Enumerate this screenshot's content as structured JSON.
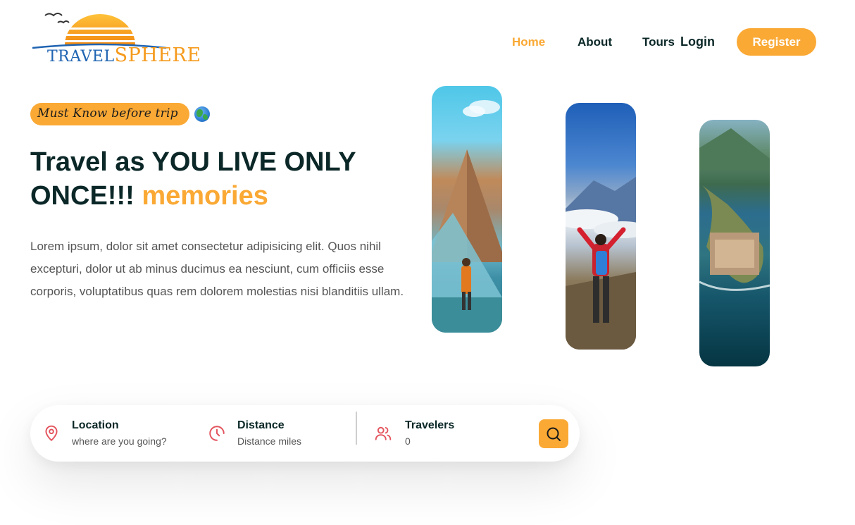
{
  "brand": {
    "logo_text_part1": "TRAVEL",
    "logo_text_part2": "SPHERE",
    "colors": {
      "accent": "#faa935",
      "heading": "#0b2727",
      "logo_blue": "#1f64b2",
      "icon_red": "#e4545e"
    }
  },
  "nav": {
    "links": [
      {
        "label": "Home",
        "active": true
      },
      {
        "label": "About",
        "active": false
      },
      {
        "label": "Tours",
        "active": false
      }
    ],
    "login_label": "Login",
    "register_label": "Register"
  },
  "hero": {
    "subtitle": "Must Know before trip",
    "subtitle_icon": "globe-icon",
    "headline_main": "Travel as YOU LIVE ONLY ONCE!!! ",
    "headline_highlight": "memories",
    "description": "Lorem ipsum, dolor sit amet consectetur adipisicing elit. Quos nihil excepturi, dolor ut ab minus ducimus ea nesciunt, cum officiis esse corporis, voluptatibus quas rem dolorem molestias nisi blanditiis ullam.",
    "images": [
      "louvre-pyramid-photo",
      "mountain-hiker-photo",
      "coastal-fort-aerial-photo"
    ]
  },
  "search": {
    "location": {
      "label": "Location",
      "placeholder": "where are you going?",
      "icon": "map-pin-icon"
    },
    "distance": {
      "label": "Distance",
      "placeholder": "Distance miles",
      "icon": "clock-icon"
    },
    "travelers": {
      "label": "Travelers",
      "placeholder": "0",
      "icon": "users-icon"
    },
    "button_icon": "search-icon"
  }
}
